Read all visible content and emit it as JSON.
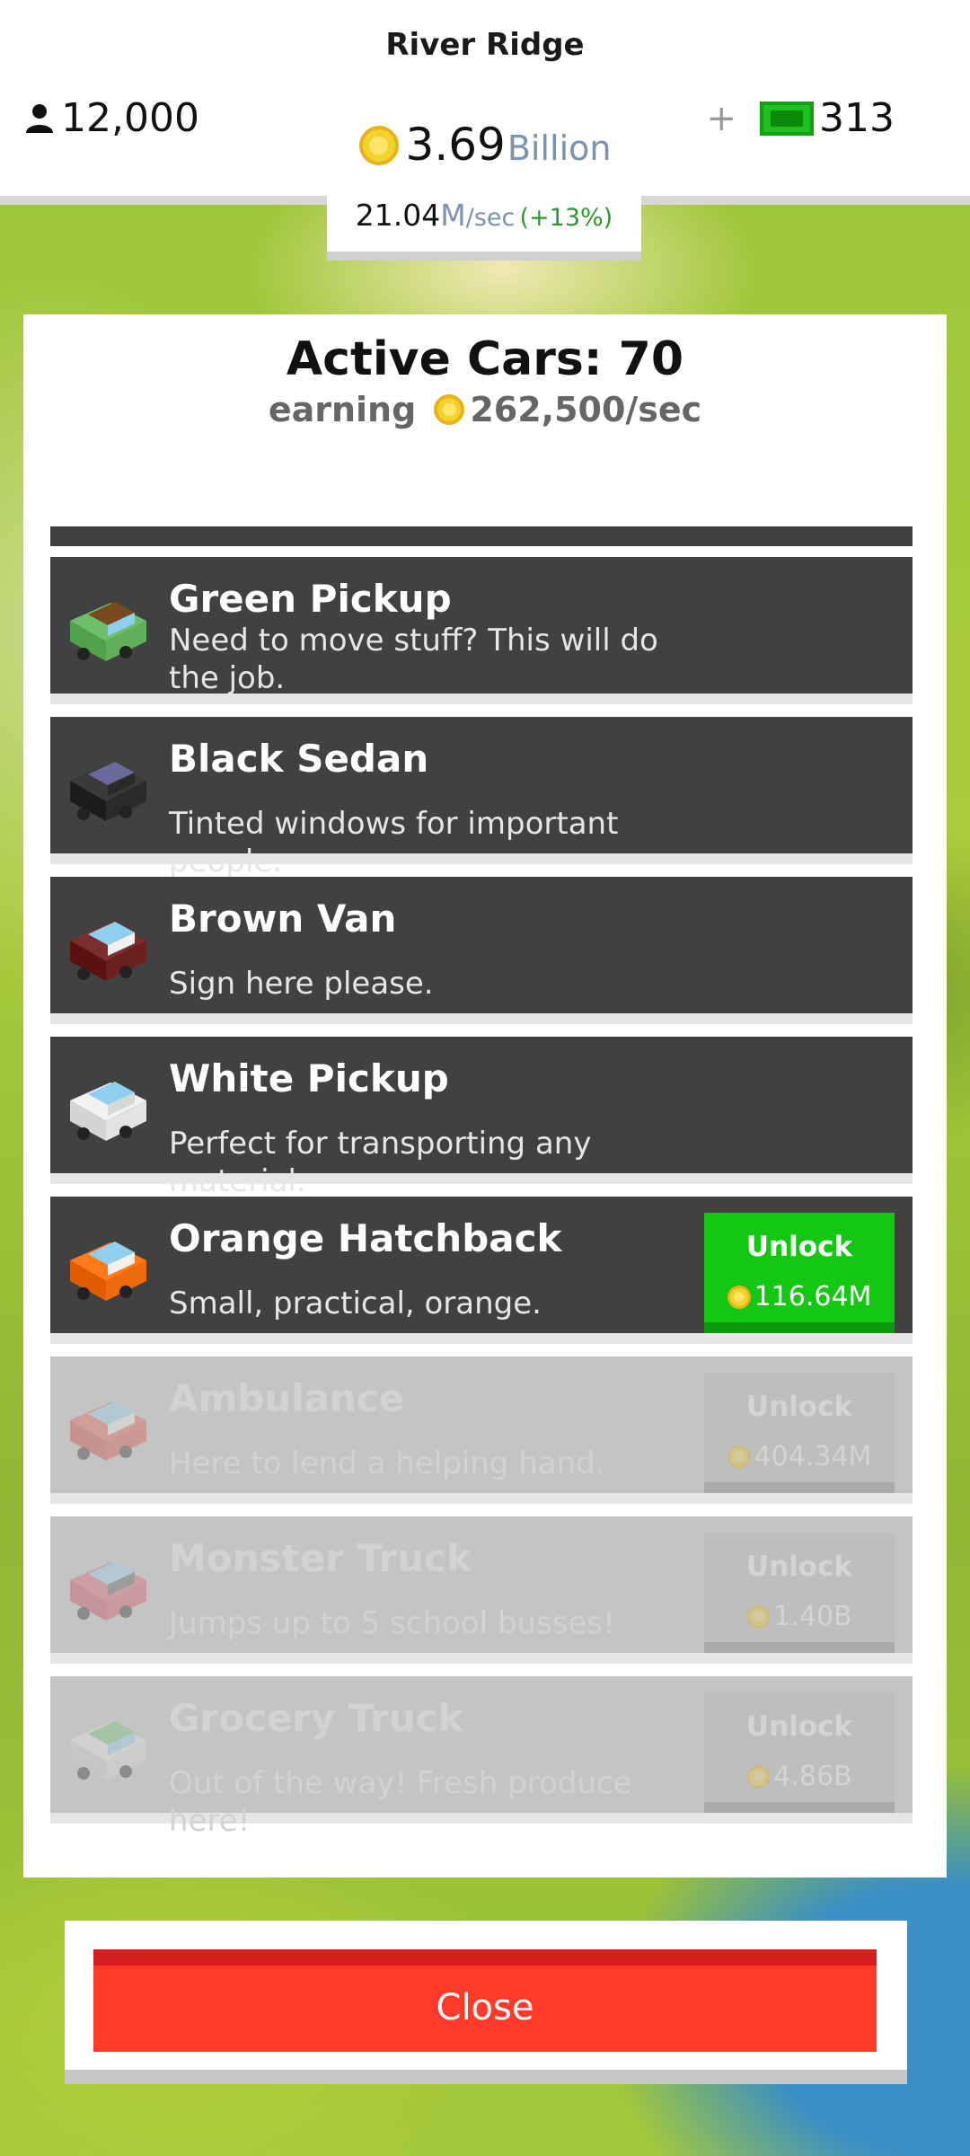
{
  "header": {
    "city_name": "River Ridge",
    "population": "12,000",
    "money_value": "3.69",
    "money_unit": "Billion",
    "gem_plus": "+",
    "gems": "313",
    "rate_value": "21.04",
    "rate_unit": "M",
    "rate_suffix": "/sec",
    "rate_bonus": "(+13%)"
  },
  "panel": {
    "title": "Active Cars: 70",
    "earning_label": "earning",
    "earning_value": "262,500/sec"
  },
  "cars": [
    {
      "name": "Green Pickup",
      "desc": "Need to move stuff? This will do the job.",
      "state": "unlocked",
      "colors": [
        "#6fbf6a",
        "#7a4a1e",
        "#8fd0f0"
      ]
    },
    {
      "name": "Black Sedan",
      "desc": "Tinted windows for important people.",
      "state": "unlocked",
      "colors": [
        "#3a3a3a",
        "#6a6a9a",
        "#2a2a2a"
      ]
    },
    {
      "name": "Brown Van",
      "desc": "Sign here please.",
      "state": "unlocked",
      "colors": [
        "#7a2e2e",
        "#8fd0f0",
        "#f0f0f0"
      ]
    },
    {
      "name": "White Pickup",
      "desc": "Perfect for transporting any material.",
      "state": "unlocked",
      "colors": [
        "#f2f2f2",
        "#8fd0f0",
        "#d8d8d8"
      ]
    },
    {
      "name": "Orange Hatchback",
      "desc": "Small, practical, orange.",
      "state": "available",
      "unlock_label": "Unlock",
      "price": "116.64M",
      "colors": [
        "#ff7a1a",
        "#8fd0f0",
        "#f0f0f0"
      ]
    },
    {
      "name": "Ambulance",
      "desc": "Here to lend a helping hand.",
      "state": "locked",
      "unlock_label": "Unlock",
      "price": "404.34M",
      "colors": [
        "#e85a4a",
        "#8fd0f0",
        "#f0f0f0"
      ]
    },
    {
      "name": "Monster Truck",
      "desc": "Jumps up to 5 school busses!",
      "state": "locked",
      "unlock_label": "Unlock",
      "price": "1.40B",
      "colors": [
        "#e05a6a",
        "#8fd0f0",
        "#555555"
      ]
    },
    {
      "name": "Grocery Truck",
      "desc": "Out of the way! Fresh produce here!",
      "state": "locked",
      "unlock_label": "Unlock",
      "price": "4.86B",
      "colors": [
        "#e8e8e8",
        "#6fbf6a",
        "#8fd0f0"
      ]
    }
  ],
  "close_label": "Close",
  "colors": {
    "unlock_green": "#13c713",
    "close_red": "#ff3a2a",
    "row_dark": "#414141",
    "row_locked": "#c4c4c4"
  }
}
